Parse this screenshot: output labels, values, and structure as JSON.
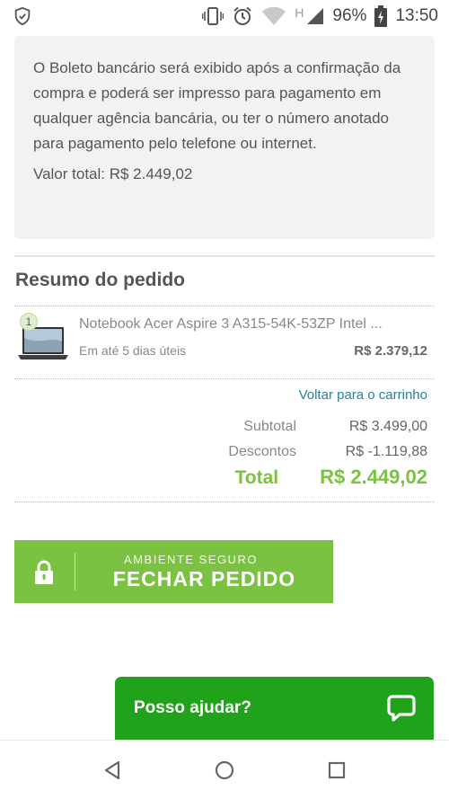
{
  "status_bar": {
    "battery_percent": "96%",
    "network_type": "H",
    "time": "13:50",
    "icons": [
      "shield-icon",
      "vibrate-icon",
      "alarm-icon",
      "wifi-icon",
      "cell-signal-icon",
      "battery-charging-icon"
    ]
  },
  "info": {
    "text": "O Boleto bancário será exibido após a confirmação da compra e poderá ser impresso para pagamento em qualquer agência bancária, ou ter o número anotado para pagamento pelo telefone ou internet.",
    "total": "Valor total: R$ 2.449,02"
  },
  "summary": {
    "title": "Resumo do pedido",
    "item": {
      "quantity": "1",
      "name": "Notebook Acer Aspire 3 A315-54K-53ZP Intel ...",
      "delivery": "Em até 5 dias úteis",
      "price": "R$ 2.379,12"
    },
    "back_link": "Voltar para o carrinho",
    "subtotal_label": "Subtotal",
    "subtotal_value": "R$ 3.499,00",
    "discount_label": "Descontos",
    "discount_value": "R$ -1.119,88",
    "total_label": "Total",
    "total_value": "R$ 2.449,02"
  },
  "checkout": {
    "small_label": "AMBIENTE SEGURO",
    "big_label": "FECHAR PEDIDO",
    "icon": "lock-icon"
  },
  "help": {
    "label": "Posso ajudar?",
    "icon": "chat-bubble-icon"
  },
  "nav": {
    "icons": [
      "back-triangle-icon",
      "home-circle-icon",
      "recents-square-icon"
    ]
  },
  "colors": {
    "accent_green": "#7cc242",
    "chat_green": "#20a31b",
    "link_blue": "#1c86a4"
  }
}
